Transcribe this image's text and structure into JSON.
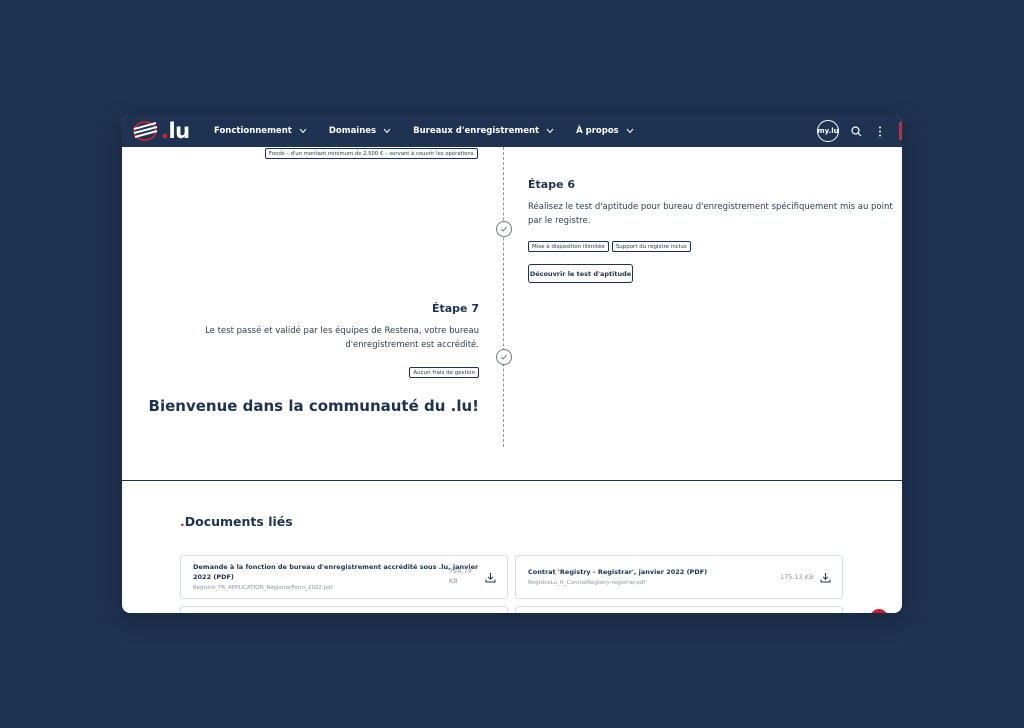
{
  "nav": {
    "logo_text": ".lu",
    "menu": [
      {
        "label": "Fonctionnement"
      },
      {
        "label": "Domaines"
      },
      {
        "label": "Bureaux d'enregistrement"
      },
      {
        "label": "À propos"
      }
    ],
    "mylu_label": "my.lu"
  },
  "top_partial": {
    "tag": "Fonds – d'un montant minimum de 2.500 € – servant à couvrir les opérations"
  },
  "step6": {
    "title": "Étape 6",
    "text_line1": "Réalisez le test d'aptitude pour bureau d'enregistrement spécifiquement mis au point",
    "text_line2": "par le registre.",
    "tags": [
      "Mise à disposition illimitée",
      "Support du registre inclus"
    ],
    "button": "Découvrir le test d'aptitude"
  },
  "step7": {
    "title": "Étape 7",
    "text_line1": "Le test passé et validé par les équipes de Restena, votre bureau",
    "text_line2": "d'enregistrement est accrédité.",
    "tag": "Aucun frais de gestion"
  },
  "welcome": "Bienvenue dans la communauté du .lu!",
  "documents": {
    "title": "Documents liés",
    "items": [
      {
        "title_line1": "Demande à la fonction de bureau d'enregistrement accrédité sous .lu, janvier",
        "title_line2": "2022 (PDF)",
        "file": "Registre_FR_APPLICATION_RegistrarForm_2022.pdf",
        "size_line1": "724.79",
        "size_line2": "KB"
      },
      {
        "title_line1": "Contrat 'Registry - Registrar', janvier 2022 (PDF)",
        "file": "RegistreLu_fr_ContratRegistry-registrar.pdf",
        "size_line1": "175.13 KB"
      }
    ]
  },
  "colors": {
    "navy": "#1e3251",
    "accent_red": "#e0202a",
    "background": "#1e3251"
  }
}
